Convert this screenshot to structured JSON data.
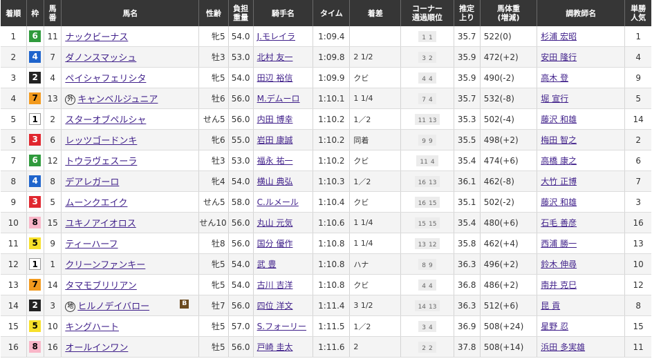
{
  "headers": {
    "rank": "着順",
    "frame": "枠",
    "horse_no": [
      "馬",
      "番"
    ],
    "horse_name": "馬名",
    "sex_age": "性齢",
    "weight_carried": [
      "負担",
      "重量"
    ],
    "jockey": "騎手名",
    "time": "タイム",
    "margin": "着差",
    "corner": [
      "コーナー",
      "通過順位"
    ],
    "last3f": [
      "推定",
      "上り"
    ],
    "body_weight": [
      "馬体重",
      "(増減)"
    ],
    "trainer": "調教師名",
    "popularity": [
      "単勝",
      "人気"
    ]
  },
  "rows": [
    {
      "rank": "1",
      "frame": "6",
      "no": "11",
      "mark": "",
      "name": "ナックビーナス",
      "blinker": "",
      "sexage": "牝5",
      "wt": "54.0",
      "jockey": "J.モレイラ",
      "time": "1:09.4",
      "margin": "",
      "c1": "1",
      "c2": "1",
      "last3f": "35.7",
      "bw": "522(0)",
      "trainer": "杉浦 宏昭",
      "pop": "1"
    },
    {
      "rank": "2",
      "frame": "4",
      "no": "7",
      "mark": "",
      "name": "ダノンスマッシュ",
      "blinker": "",
      "sexage": "牡3",
      "wt": "53.0",
      "jockey": "北村 友一",
      "time": "1:09.8",
      "margin": "2 1/2",
      "c1": "3",
      "c2": "2",
      "last3f": "35.9",
      "bw": "472(+2)",
      "trainer": "安田 隆行",
      "pop": "4"
    },
    {
      "rank": "3",
      "frame": "2",
      "no": "4",
      "mark": "",
      "name": "ペイシャフェリシタ",
      "blinker": "",
      "sexage": "牝5",
      "wt": "54.0",
      "jockey": "田辺 裕信",
      "time": "1:09.9",
      "margin": "クビ",
      "c1": "4",
      "c2": "4",
      "last3f": "35.9",
      "bw": "490(-2)",
      "trainer": "高木 登",
      "pop": "9"
    },
    {
      "rank": "4",
      "frame": "7",
      "no": "13",
      "mark": "外",
      "name": "キャンベルジュニア",
      "blinker": "",
      "sexage": "牡6",
      "wt": "56.0",
      "jockey": "M.デムーロ",
      "time": "1:10.1",
      "margin": "1 1/4",
      "c1": "7",
      "c2": "4",
      "last3f": "35.7",
      "bw": "532(-8)",
      "trainer": "堀 宣行",
      "pop": "5"
    },
    {
      "rank": "5",
      "frame": "1",
      "no": "2",
      "mark": "",
      "name": "スターオブペルシャ",
      "blinker": "",
      "sexage": "せん5",
      "wt": "56.0",
      "jockey": "内田 博幸",
      "time": "1:10.2",
      "margin": "1／2",
      "c1": "11",
      "c2": "13",
      "last3f": "35.3",
      "bw": "502(-4)",
      "trainer": "藤沢 和雄",
      "pop": "14"
    },
    {
      "rank": "5",
      "frame": "3",
      "no": "6",
      "mark": "",
      "name": "レッツゴードンキ",
      "blinker": "",
      "sexage": "牝6",
      "wt": "55.0",
      "jockey": "岩田 康誠",
      "time": "1:10.2",
      "margin": "同着",
      "c1": "9",
      "c2": "9",
      "last3f": "35.5",
      "bw": "498(+2)",
      "trainer": "梅田 智之",
      "pop": "2"
    },
    {
      "rank": "7",
      "frame": "6",
      "no": "12",
      "mark": "",
      "name": "トウラヴェスーラ",
      "blinker": "",
      "sexage": "牡3",
      "wt": "53.0",
      "jockey": "福永 祐一",
      "time": "1:10.2",
      "margin": "クビ",
      "c1": "11",
      "c2": "4",
      "last3f": "35.4",
      "bw": "474(+6)",
      "trainer": "高橋 康之",
      "pop": "6"
    },
    {
      "rank": "8",
      "frame": "4",
      "no": "8",
      "mark": "",
      "name": "デアレガーロ",
      "blinker": "",
      "sexage": "牝4",
      "wt": "54.0",
      "jockey": "横山 典弘",
      "time": "1:10.3",
      "margin": "1／2",
      "c1": "16",
      "c2": "13",
      "last3f": "36.1",
      "bw": "462(-8)",
      "trainer": "大竹 正博",
      "pop": "7"
    },
    {
      "rank": "9",
      "frame": "3",
      "no": "5",
      "mark": "",
      "name": "ムーンクエイク",
      "blinker": "",
      "sexage": "せん5",
      "wt": "58.0",
      "jockey": "C.ルメール",
      "time": "1:10.4",
      "margin": "クビ",
      "c1": "16",
      "c2": "15",
      "last3f": "35.1",
      "bw": "502(-2)",
      "trainer": "藤沢 和雄",
      "pop": "3"
    },
    {
      "rank": "10",
      "frame": "8",
      "no": "15",
      "mark": "",
      "name": "ユキノアイオロス",
      "blinker": "",
      "sexage": "せん10",
      "wt": "56.0",
      "jockey": "丸山 元気",
      "time": "1:10.6",
      "margin": "1 1/4",
      "c1": "15",
      "c2": "15",
      "last3f": "35.4",
      "bw": "480(+6)",
      "trainer": "石毛 善彦",
      "pop": "16"
    },
    {
      "rank": "11",
      "frame": "5",
      "no": "9",
      "mark": "",
      "name": "ティーハーフ",
      "blinker": "",
      "sexage": "牡8",
      "wt": "56.0",
      "jockey": "国分 優作",
      "time": "1:10.8",
      "margin": "1 1/4",
      "c1": "13",
      "c2": "12",
      "last3f": "35.8",
      "bw": "462(+4)",
      "trainer": "西浦 勝一",
      "pop": "13"
    },
    {
      "rank": "12",
      "frame": "1",
      "no": "1",
      "mark": "",
      "name": "クリーンファンキー",
      "blinker": "",
      "sexage": "牝5",
      "wt": "54.0",
      "jockey": "武 豊",
      "time": "1:10.8",
      "margin": "ハナ",
      "c1": "8",
      "c2": "9",
      "last3f": "36.3",
      "bw": "496(+2)",
      "trainer": "鈴木 伸尋",
      "pop": "10"
    },
    {
      "rank": "13",
      "frame": "7",
      "no": "14",
      "mark": "",
      "name": "タマモブリリアン",
      "blinker": "",
      "sexage": "牝5",
      "wt": "54.0",
      "jockey": "古川 吉洋",
      "time": "1:10.8",
      "margin": "クビ",
      "c1": "4",
      "c2": "4",
      "last3f": "36.8",
      "bw": "486(+2)",
      "trainer": "南井 克巳",
      "pop": "12"
    },
    {
      "rank": "14",
      "frame": "2",
      "no": "3",
      "mark": "地",
      "name": "ヒルノデイバロー",
      "blinker": "B",
      "sexage": "牡7",
      "wt": "56.0",
      "jockey": "四位 洋文",
      "time": "1:11.4",
      "margin": "3 1/2",
      "c1": "14",
      "c2": "13",
      "last3f": "36.3",
      "bw": "512(+6)",
      "trainer": "昆 貢",
      "pop": "8"
    },
    {
      "rank": "15",
      "frame": "5",
      "no": "10",
      "mark": "",
      "name": "キングハート",
      "blinker": "",
      "sexage": "牡5",
      "wt": "57.0",
      "jockey": "S.フォーリー",
      "time": "1:11.5",
      "margin": "1／2",
      "c1": "3",
      "c2": "4",
      "last3f": "36.9",
      "bw": "508(+24)",
      "trainer": "星野 忍",
      "pop": "15"
    },
    {
      "rank": "16",
      "frame": "8",
      "no": "16",
      "mark": "",
      "name": "オールインワン",
      "blinker": "",
      "sexage": "牡5",
      "wt": "56.0",
      "jockey": "戸崎 圭太",
      "time": "1:11.6",
      "margin": "2",
      "c1": "2",
      "c2": "2",
      "last3f": "37.8",
      "bw": "508(+14)",
      "trainer": "浜田 多実雄",
      "pop": "11"
    }
  ]
}
